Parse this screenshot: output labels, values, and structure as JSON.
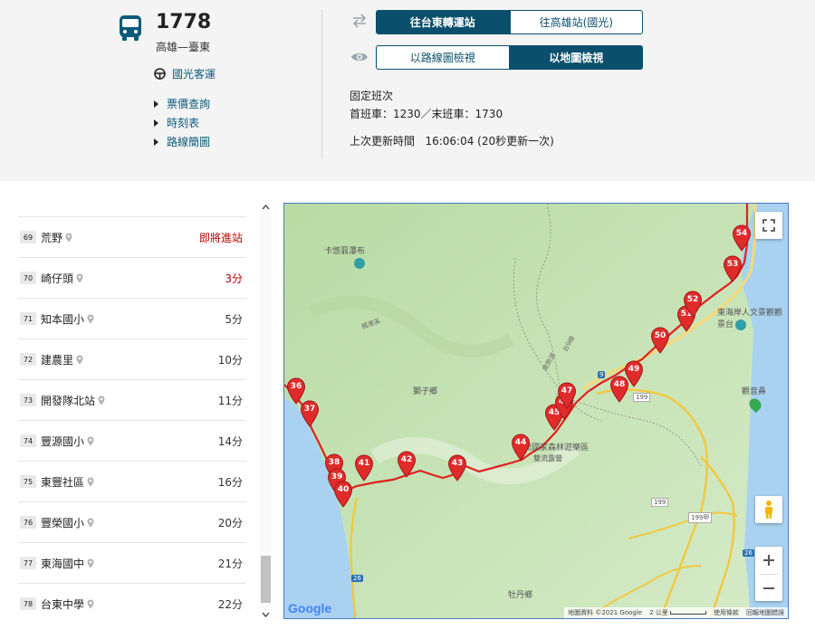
{
  "route": {
    "number": "1778",
    "description": "高雄—臺東",
    "operator": "國光客運"
  },
  "links": [
    "票價查詢",
    "時刻表",
    "路線簡圖"
  ],
  "direction_buttons": [
    "往台東轉運站",
    "往高雄站(國光)"
  ],
  "view_buttons": [
    "以路線圖檢視",
    "以地圖檢視"
  ],
  "schedule": {
    "type": "固定班次",
    "first_last": "首班車：1230／末班車：1730",
    "update_label": "上次更新時間",
    "update_time": "16:06:04 (20秒更新一次)"
  },
  "stops": [
    {
      "seq": "69",
      "name": "荒野",
      "eta": "即將進站",
      "highlight": true
    },
    {
      "seq": "70",
      "name": "崎仔頭",
      "eta": "3分",
      "highlight": true
    },
    {
      "seq": "71",
      "name": "知本國小",
      "eta": "5分",
      "highlight": false
    },
    {
      "seq": "72",
      "name": "建農里",
      "eta": "10分",
      "highlight": false
    },
    {
      "seq": "73",
      "name": "開發隊北站",
      "eta": "11分",
      "highlight": false
    },
    {
      "seq": "74",
      "name": "豐源國小",
      "eta": "14分",
      "highlight": false
    },
    {
      "seq": "75",
      "name": "東豐社區",
      "eta": "16分",
      "highlight": false
    },
    {
      "seq": "76",
      "name": "豐榮國小",
      "eta": "20分",
      "highlight": false
    },
    {
      "seq": "77",
      "name": "東海國中",
      "eta": "21分",
      "highlight": false
    },
    {
      "seq": "78",
      "name": "台東中學",
      "eta": "22分",
      "highlight": false
    }
  ],
  "map": {
    "labels": {
      "waterfall": "卡悠蓊瀑布",
      "shizi": "獅子鄉",
      "forest": "雙流國家森林遊樂區",
      "forest_sub": "雙流露營",
      "scenic": "東海岸人文景觀觀景台",
      "guanyin": "觀音鼻",
      "mudan": "牡丹鄉",
      "hwy199": "199",
      "hwy199b": "199",
      "hwy199c": "199甲",
      "hwy9": "9",
      "hwy26": "26",
      "hwy26b": "26",
      "river1": "楓港溪",
      "river2": "南勢湖",
      "road": "台9線"
    },
    "markers": [
      "36",
      "37",
      "38",
      "39",
      "40",
      "41",
      "42",
      "43",
      "44",
      "45",
      "46",
      "47",
      "48",
      "49",
      "50",
      "51",
      "52",
      "53",
      "54"
    ],
    "attribution": [
      "地圖資料 ©2021 Google",
      "2 公里",
      "使用條款",
      "回報地圖錯誤"
    ],
    "google_logo": "Google",
    "colors": {
      "route": "#e02020",
      "sea": "#a9d2f0",
      "land": "#cfe6c0"
    }
  }
}
